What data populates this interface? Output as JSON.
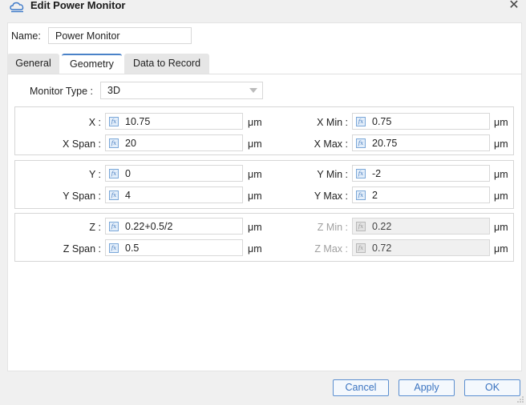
{
  "window": {
    "title": "Edit Power Monitor",
    "close_glyph": "✕",
    "app_icon": "cloud-icon"
  },
  "name": {
    "label": "Name:",
    "value": "Power Monitor"
  },
  "tabs": [
    {
      "label": "General",
      "active": false
    },
    {
      "label": "Geometry",
      "active": true
    },
    {
      "label": "Data to Record",
      "active": false
    }
  ],
  "monitor_type": {
    "label": "Monitor Type :",
    "value": "3D"
  },
  "fx_glyph": "fx",
  "unit": "μm",
  "rows": [
    {
      "left": {
        "label": "X :",
        "value": "10.75",
        "disabled": false
      },
      "right": {
        "label": "X Min :",
        "value": "0.75",
        "disabled": false
      }
    },
    {
      "left": {
        "label": "X Span :",
        "value": "20",
        "disabled": false
      },
      "right": {
        "label": "X Max :",
        "value": "20.75",
        "disabled": false
      }
    },
    {
      "left": {
        "label": "Y :",
        "value": "0",
        "disabled": false
      },
      "right": {
        "label": "Y Min :",
        "value": "-2",
        "disabled": false
      }
    },
    {
      "left": {
        "label": "Y Span :",
        "value": "4",
        "disabled": false
      },
      "right": {
        "label": "Y Max :",
        "value": "2",
        "disabled": false
      }
    },
    {
      "left": {
        "label": "Z :",
        "value": "0.22+0.5/2",
        "disabled": false
      },
      "right": {
        "label": "Z Min :",
        "value": "0.22",
        "disabled": true
      }
    },
    {
      "left": {
        "label": "Z Span :",
        "value": "0.5",
        "disabled": false
      },
      "right": {
        "label": "Z Max :",
        "value": "0.72",
        "disabled": true
      }
    }
  ],
  "buttons": {
    "cancel": "Cancel",
    "apply": "Apply",
    "ok": "OK"
  },
  "colors": {
    "accent": "#4a82c8",
    "button_text": "#3a73c0",
    "disabled_text": "#a0a0a0"
  }
}
